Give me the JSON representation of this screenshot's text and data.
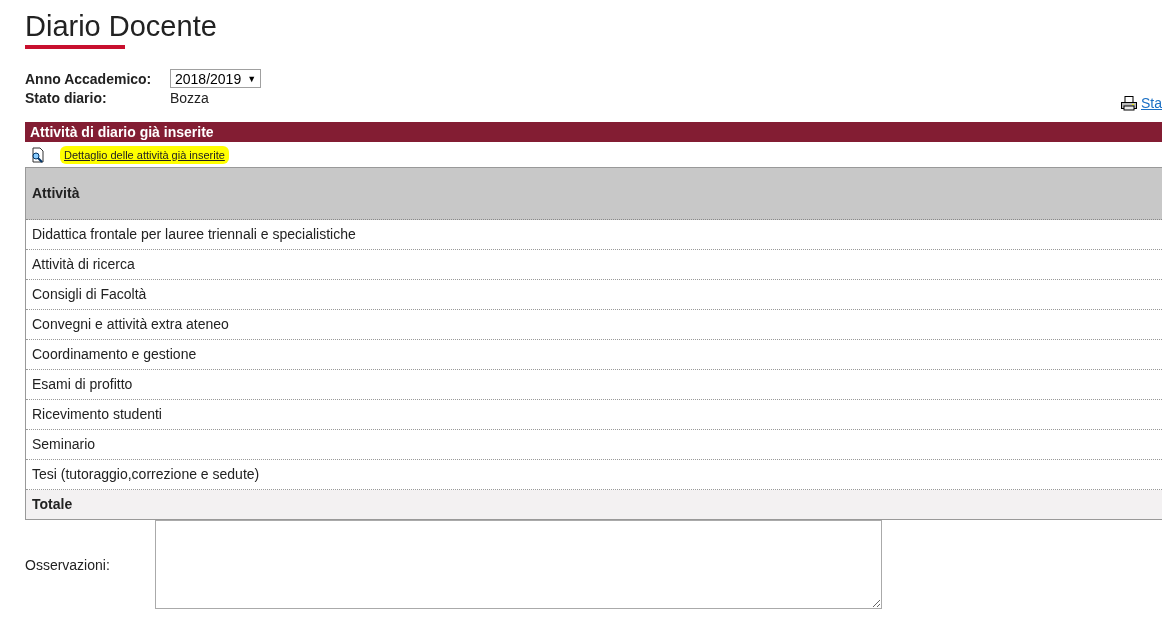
{
  "title": "Diario Docente",
  "fields": [
    {
      "label": "Anno Accademico:",
      "kind": "select",
      "value": "2018/2019",
      "caret": "▼"
    },
    {
      "label": "Stato diario:",
      "kind": "text",
      "value": "Bozza"
    }
  ],
  "print_link": "Sta",
  "section": {
    "title": "Attività di diario già inserite",
    "detail_link": "Dettaglio delle attività già inserite",
    "detail_highlighted": true
  },
  "table": {
    "columns": [
      "Attività"
    ],
    "rows": [
      "Didattica frontale per lauree triennali e specialistiche",
      "Attività di ricerca",
      "Consigli di Facoltà",
      "Convegni e attività extra ateneo",
      "Coordinamento e gestione",
      "Esami di profitto",
      "Ricevimento studenti",
      "Seminario",
      "Tesi (tutoraggio,correzione e sedute)"
    ],
    "total": "Totale"
  },
  "observations": {
    "label": "Osservazioni:"
  }
}
